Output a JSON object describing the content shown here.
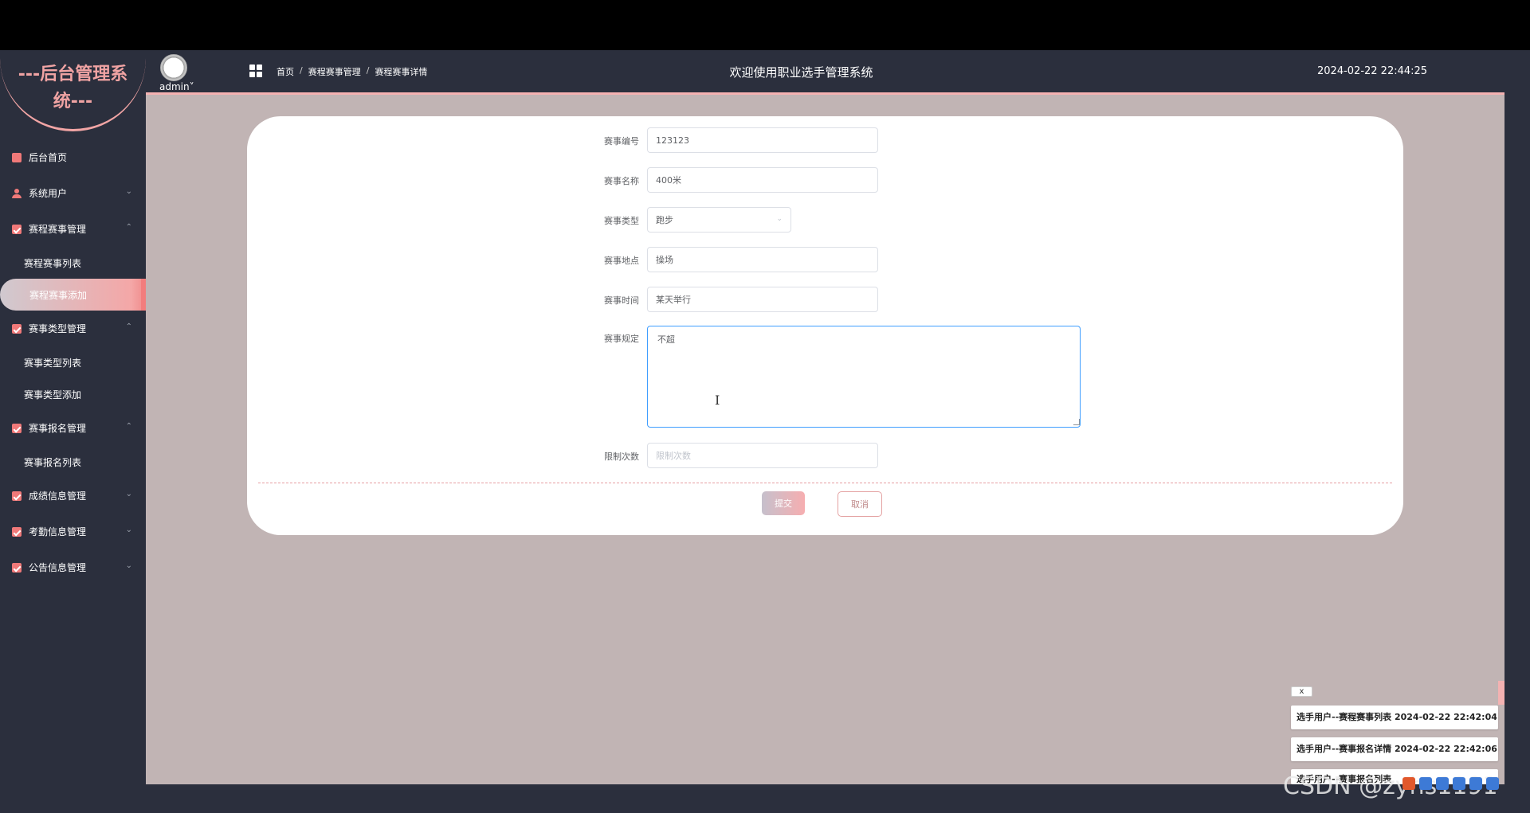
{
  "sidebar": {
    "logo_text": "---后台管理系统---",
    "menu": {
      "home": "后台首页",
      "system_users": "系统用户",
      "schedule_mgmt": "赛程赛事管理",
      "schedule_list": "赛程赛事列表",
      "schedule_add": "赛程赛事添加",
      "type_mgmt": "赛事类型管理",
      "type_list": "赛事类型列表",
      "type_add": "赛事类型添加",
      "signup_mgmt": "赛事报名管理",
      "signup_list": "赛事报名列表",
      "score_mgmt": "成绩信息管理",
      "attendance_mgmt": "考勤信息管理",
      "notice_mgmt": "公告信息管理"
    }
  },
  "header": {
    "admin_name": "admin",
    "admin_caret": "˅",
    "breadcrumb": [
      "首页",
      "赛程赛事管理",
      "赛程赛事详情"
    ],
    "breadcrumb_sep": "/",
    "title": "欢迎使用职业选手管理系统",
    "datetime": "2024-02-22 22:44:25"
  },
  "form": {
    "event_no": {
      "label": "赛事编号",
      "value": "123123"
    },
    "event_name": {
      "label": "赛事名称",
      "value": "400米"
    },
    "event_type": {
      "label": "赛事类型",
      "value": "跑步"
    },
    "event_location": {
      "label": "赛事地点",
      "value": "操场"
    },
    "event_time": {
      "label": "赛事时间",
      "value": "某天举行"
    },
    "event_rules": {
      "label": "赛事规定",
      "value": "不超"
    },
    "limit_count": {
      "label": "限制次数",
      "placeholder": "限制次数",
      "value": ""
    },
    "submit_label": "提交",
    "cancel_label": "取消"
  },
  "notifications": {
    "close_label": "x",
    "items": [
      "选手用户--赛程赛事列表 2024-02-22 22:42:04",
      "选手用户--赛事报名详情 2024-02-22 22:42:06",
      "选手用户--赛事报名列表"
    ]
  },
  "watermark": "CSDN @zyhs1191",
  "colors": {
    "accent": "#f07979",
    "sidebar_bg": "#2b2f3d",
    "content_bg": "#c1b4b4",
    "focus_border": "#409eff"
  }
}
